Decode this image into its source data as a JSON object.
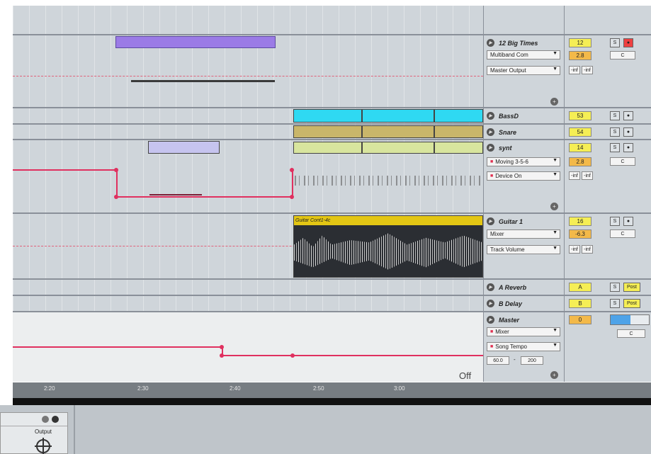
{
  "tracks": [
    {
      "name": "12 Big Times",
      "dropdowns": [
        "Multiband Com",
        "Master Output"
      ],
      "volume": "12",
      "send_value": "2.8",
      "pan": "C",
      "inf1": "-inf",
      "inf2": "-inf",
      "solo": "S"
    },
    {
      "name": "BassD",
      "volume": "53",
      "solo": "S"
    },
    {
      "name": "Snare",
      "volume": "54",
      "solo": "S"
    },
    {
      "name": "synt",
      "dropdowns": [
        "Moving 3-5-6",
        "Device On"
      ],
      "volume": "14",
      "send_value": "2.8",
      "pan": "C",
      "inf1": "-inf",
      "inf2": "-inf",
      "solo": "S"
    },
    {
      "name": "Guitar 1",
      "dropdowns": [
        "Mixer",
        "Track Volume"
      ],
      "volume": "16",
      "send_value": "-6.3",
      "pan": "C",
      "inf1": "-inf",
      "inf2": "-inf",
      "solo": "S",
      "clip_name": "Guitar Cont1-4c"
    },
    {
      "name": "A Reverb",
      "send_letter": "A",
      "solo": "S",
      "post": "Post"
    },
    {
      "name": "B Delay",
      "send_letter": "B",
      "solo": "S",
      "post": "Post"
    },
    {
      "name": "Master",
      "dropdowns": [
        "Mixer",
        "Song Tempo"
      ],
      "volume": "0",
      "pan": "C",
      "tempo_min": "60.0",
      "tempo_max": "200",
      "tempo_dash": "-",
      "off_label": "Off"
    }
  ],
  "timeline": [
    "2:20",
    "2:30",
    "2:40",
    "2:50",
    "3:00"
  ],
  "bottom": {
    "output_label": "Output"
  },
  "colors": {
    "cyan_clip": "#2fd9f2",
    "olive_clip": "#c9b66a",
    "lime_clip": "#d8e59e",
    "purple_clip": "#9b7be6",
    "lavender_clip": "#c6c4ef",
    "yellow_clip": "#e3c614",
    "automation": "#e0305f"
  }
}
